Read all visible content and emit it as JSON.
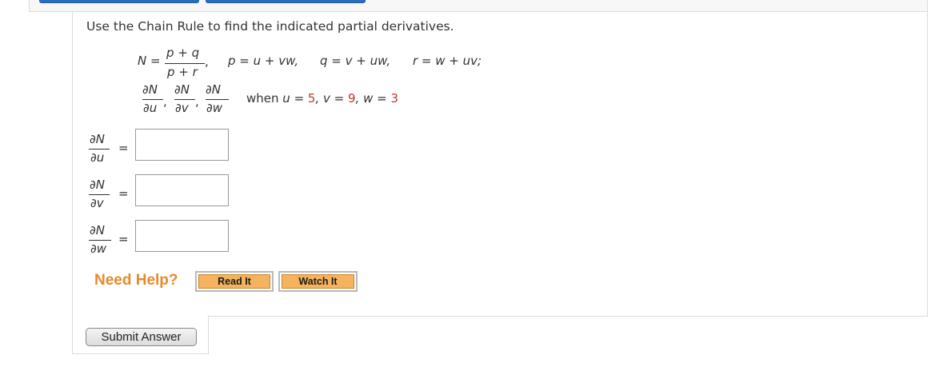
{
  "question": {
    "instruction": "Use the Chain Rule to find the indicated partial derivatives.",
    "function": {
      "lhs": "N =",
      "numerator": "p + q",
      "denominator": "p + r",
      "trailing_comma": ","
    },
    "relations": [
      "p = u + vw,",
      "q = v + uw,",
      "r = w + uv;"
    ],
    "requested_derivatives": {
      "numerators": [
        "∂N",
        "∂N",
        "∂N"
      ],
      "denominators": [
        "∂u",
        "∂v",
        "∂w"
      ],
      "separators": [
        ",",
        ","
      ]
    },
    "condition": {
      "prefix": "when",
      "u_label": "u =",
      "u_value": "5",
      "v_label": ", v =",
      "v_value": "9",
      "w_label": ", w =",
      "w_value": "3"
    }
  },
  "answers": [
    {
      "numerator": "∂N",
      "denominator": "∂u",
      "equals": "=",
      "value": ""
    },
    {
      "numerator": "∂N",
      "denominator": "∂v",
      "equals": "=",
      "value": ""
    },
    {
      "numerator": "∂N",
      "denominator": "∂w",
      "equals": "=",
      "value": ""
    }
  ],
  "help": {
    "label": "Need Help?",
    "read_it": "Read It",
    "watch_it": "Watch It"
  },
  "submit_label": "Submit Answer",
  "colors": {
    "given_values": "#c0392b",
    "need_help": "#e8892b",
    "help_button_fill": "#f6b35d",
    "tab_accent": "#2a6ebb"
  }
}
